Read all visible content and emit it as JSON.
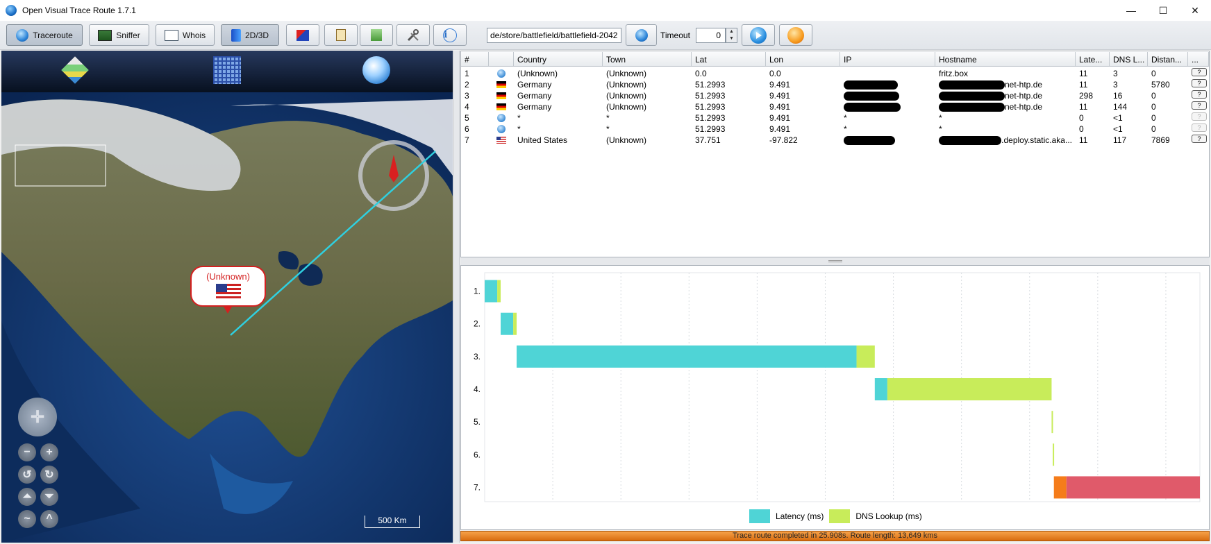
{
  "window": {
    "title": "Open Visual Trace Route 1.7.1",
    "controls": [
      "—",
      "☐",
      "✕"
    ]
  },
  "toolbar": {
    "traceroute": "Traceroute",
    "sniffer": "Sniffer",
    "whois": "Whois",
    "mode_2d3d": "2D/3D",
    "url_value": "de/store/battlefield/battlefield-2042",
    "timeout_label": "Timeout",
    "timeout_value": "0"
  },
  "map": {
    "callout_label": "(Unknown)",
    "scale_label": "500 Km"
  },
  "table": {
    "columns": [
      "#",
      "",
      "Country",
      "Town",
      "Lat",
      "Lon",
      "IP",
      "Hostname",
      "Late...",
      "DNS L...",
      "Distan...",
      "..."
    ],
    "rows": [
      {
        "num": "1",
        "flag": "unknown",
        "country": "(Unknown)",
        "town": "(Unknown)",
        "lat": "0.0",
        "lon": "0.0",
        "ip": "",
        "hostname": "fritz.box",
        "latency": "11",
        "dns": "3",
        "distance": "0",
        "btn": "?"
      },
      {
        "num": "2",
        "flag": "de",
        "country": "Germany",
        "town": "(Unknown)",
        "lat": "51.2993",
        "lon": "9.491",
        "ip": "",
        "hostname": "net-htp.de",
        "latency": "11",
        "dns": "3",
        "distance": "5780",
        "btn": "?"
      },
      {
        "num": "3",
        "flag": "de",
        "country": "Germany",
        "town": "(Unknown)",
        "lat": "51.2993",
        "lon": "9.491",
        "ip": "",
        "hostname": "net-htp.de",
        "latency": "298",
        "dns": "16",
        "distance": "0",
        "btn": "?"
      },
      {
        "num": "4",
        "flag": "de",
        "country": "Germany",
        "town": "(Unknown)",
        "lat": "51.2993",
        "lon": "9.491",
        "ip": "",
        "hostname": "net-htp.de",
        "latency": "11",
        "dns": "144",
        "distance": "0",
        "btn": "?"
      },
      {
        "num": "5",
        "flag": "unknown",
        "country": "*",
        "town": "*",
        "lat": "51.2993",
        "lon": "9.491",
        "ip": "*",
        "hostname": "*",
        "latency": "0",
        "dns": "<1",
        "distance": "0",
        "btn": "?"
      },
      {
        "num": "6",
        "flag": "unknown",
        "country": "*",
        "town": "*",
        "lat": "51.2993",
        "lon": "9.491",
        "ip": "*",
        "hostname": "*",
        "latency": "0",
        "dns": "<1",
        "distance": "0",
        "btn": "?"
      },
      {
        "num": "7",
        "flag": "us",
        "country": "United States",
        "town": "(Unknown)",
        "lat": "37.751",
        "lon": "-97.822",
        "ip": "",
        "hostname": ".deploy.static.aka...",
        "latency": "11",
        "dns": "117",
        "distance": "7869",
        "btn": "?"
      }
    ]
  },
  "gantt": {
    "labels": [
      "1.",
      "2.",
      "3.",
      "4.",
      "5.",
      "6.",
      "7."
    ],
    "legend_latency": "Latency (ms)",
    "legend_dns": "DNS Lookup (ms)",
    "colors": {
      "latency": "#4fd4d6",
      "dns": "#c8ec5a",
      "error_latency": "#f57c1a",
      "error_dns": "#e05a6a"
    },
    "hops": [
      {
        "start": 0,
        "latency": 11,
        "dns": 3
      },
      {
        "start": 14,
        "latency": 11,
        "dns": 3
      },
      {
        "start": 28,
        "latency": 298,
        "dns": 16
      },
      {
        "start": 342,
        "latency": 11,
        "dns": 144
      },
      {
        "start": 497,
        "latency": 0,
        "dns": 1
      },
      {
        "start": 498,
        "latency": 0,
        "dns": 1
      },
      {
        "start": 499,
        "latency": 11,
        "dns": 117,
        "error": true
      }
    ],
    "max_ms": 627
  },
  "status": {
    "text": "Trace route completed in 25.908s. Route length: 13,649 kms"
  }
}
